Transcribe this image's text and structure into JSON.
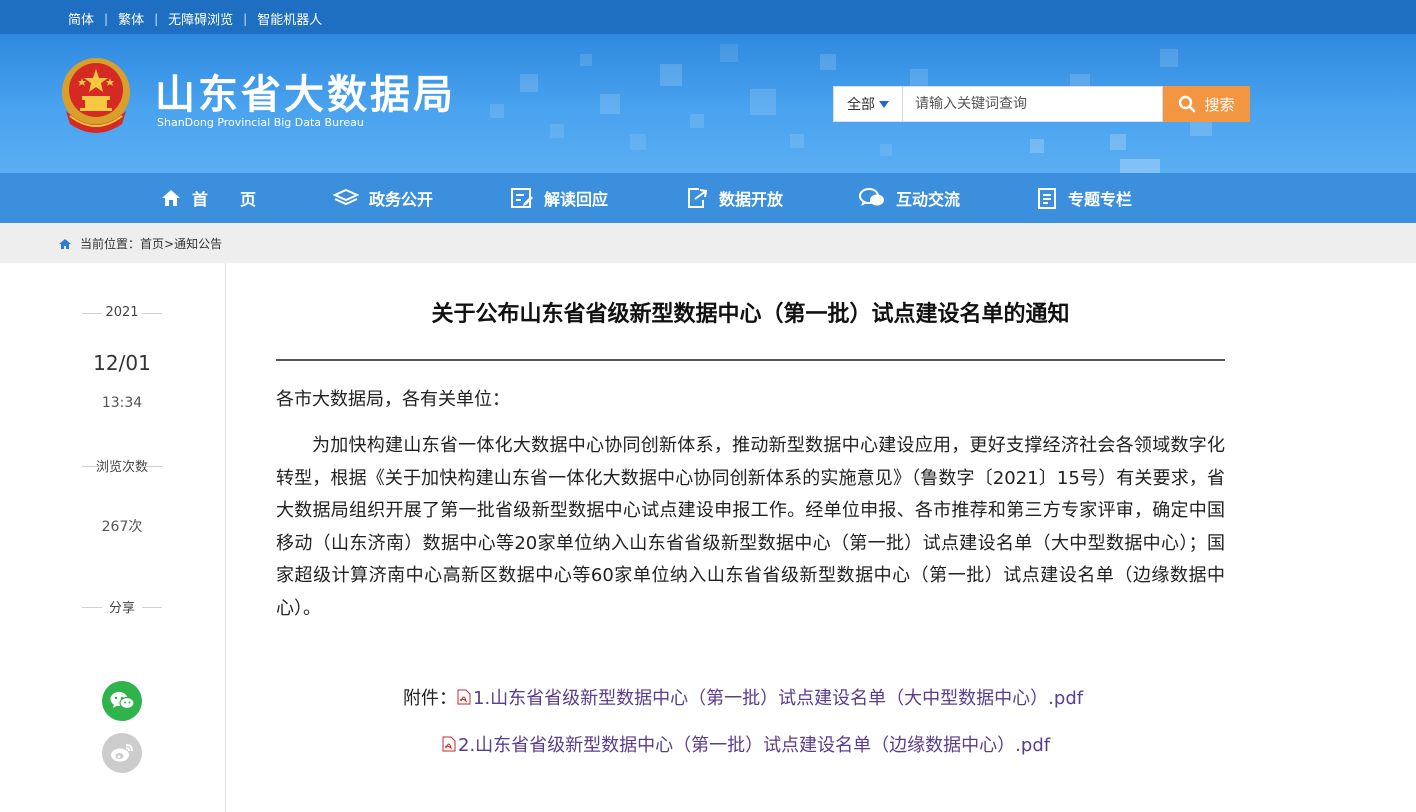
{
  "topbar": {
    "links": [
      "简体",
      "繁体",
      "无障碍浏览",
      "智能机器人"
    ],
    "separator": "|"
  },
  "header": {
    "site_title": "山东省大数据局",
    "site_subtitle": "ShanDong Provincial Big Data Bureau"
  },
  "search": {
    "scope": "全部",
    "placeholder": "请输入关键词查询",
    "button_label": "搜索"
  },
  "nav": {
    "items": [
      {
        "label": "首　　页",
        "icon": "home-icon"
      },
      {
        "label": "政务公开",
        "icon": "layers-icon"
      },
      {
        "label": "解读回应",
        "icon": "edit-doc-icon"
      },
      {
        "label": "数据开放",
        "icon": "export-icon"
      },
      {
        "label": "互动交流",
        "icon": "chat-icon"
      },
      {
        "label": "专题专栏",
        "icon": "document-icon"
      }
    ]
  },
  "breadcrumb": {
    "prefix": "当前位置：",
    "items": [
      "首页",
      "通知公告"
    ],
    "separator": ">"
  },
  "meta": {
    "year": "2021",
    "date": "12/01",
    "time": "13:34",
    "views_label": "浏览次数",
    "views": "267次",
    "share_label": "分享",
    "share_icons": [
      "wechat-icon",
      "weibo-icon"
    ]
  },
  "article": {
    "title": "关于公布山东省省级新型数据中心（第一批）试点建设名单的通知",
    "greeting": "各市大数据局，各有关单位：",
    "body": "为加快构建山东省一体化大数据中心协同创新体系，推动新型数据中心建设应用，更好支撑经济社会各领域数字化转型，根据《关于加快构建山东省一体化大数据中心协同创新体系的实施意见》（鲁数字〔2021〕15号）有关要求，省大数据局组织开展了第一批省级新型数据中心试点建设申报工作。经单位申报、各市推荐和第三方专家评审，确定中国移动（山东济南）数据中心等20家单位纳入山东省省级新型数据中心（第一批）试点建设名单（大中型数据中心）；国家超级计算济南中心高新区数据中心等60家单位纳入山东省省级新型数据中心（第一批）试点建设名单（边缘数据中心）。",
    "attachment_label": "附件：",
    "attachments": [
      "1.山东省省级新型数据中心（第一批）试点建设名单（大中型数据中心）.pdf",
      "2.山东省省级新型数据中心（第一批）试点建设名单（边缘数据中心）.pdf"
    ]
  },
  "colors": {
    "topbar": "#1e6ec2",
    "nav": "#3b8fdc",
    "search_button": "#f39642",
    "wechat": "#2fb34b",
    "weibo": "#cccccc",
    "link": "#5a3d8e"
  }
}
